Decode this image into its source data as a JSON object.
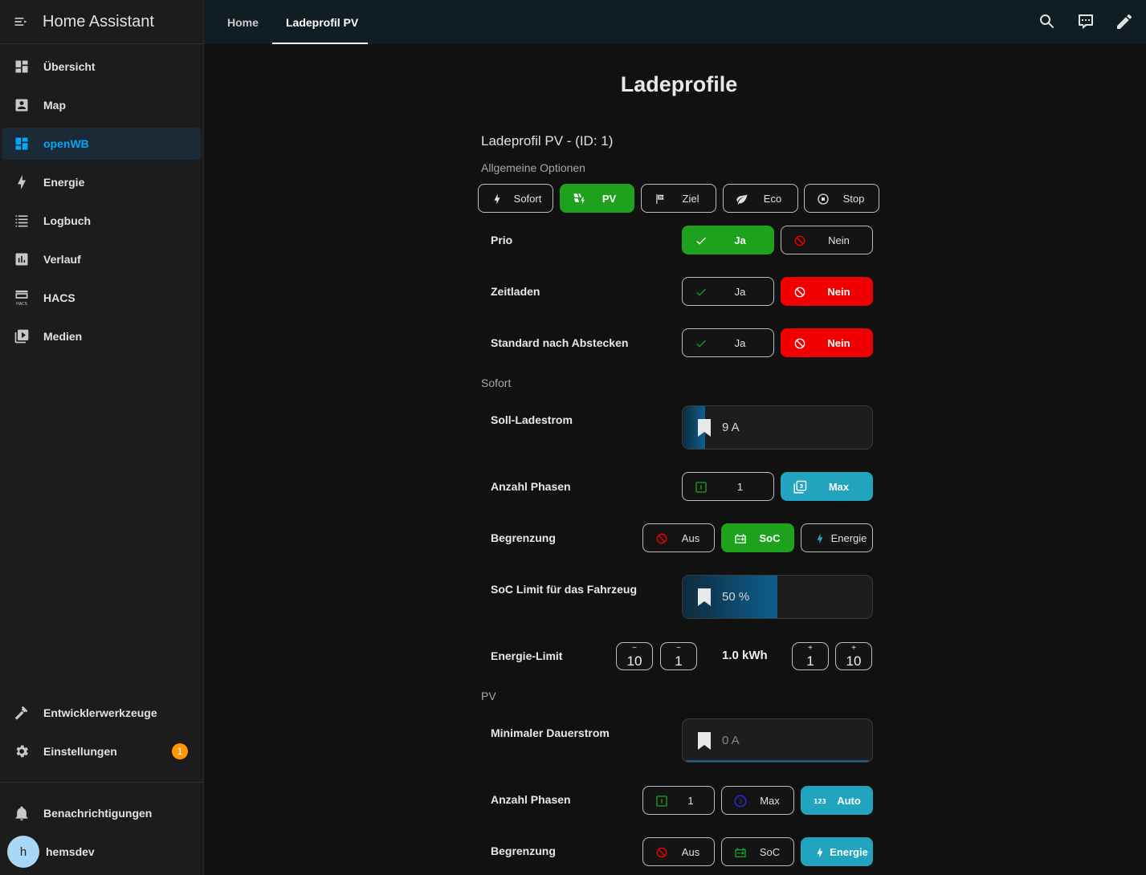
{
  "app": {
    "title": "Home Assistant"
  },
  "sidebar": {
    "items": [
      {
        "label": "Übersicht",
        "icon": "dashboard-icon"
      },
      {
        "label": "Map",
        "icon": "account-box-icon"
      },
      {
        "label": "openWB",
        "icon": "dashboard-icon",
        "active": true
      },
      {
        "label": "Energie",
        "icon": "lightning-bolt-icon"
      },
      {
        "label": "Logbuch",
        "icon": "list-icon"
      },
      {
        "label": "Verlauf",
        "icon": "chart-box-icon"
      },
      {
        "label": "HACS",
        "icon": "hacs-icon"
      },
      {
        "label": "Medien",
        "icon": "play-box-multiple-icon"
      }
    ],
    "bottom": [
      {
        "label": "Entwicklerwerkzeuge",
        "icon": "hammer-icon"
      },
      {
        "label": "Einstellungen",
        "icon": "gear-icon",
        "badge": "1"
      }
    ],
    "notifications": {
      "label": "Benachrichtigungen",
      "icon": "bell-icon"
    },
    "user": {
      "initial": "h",
      "name": "hemsdev"
    }
  },
  "topbar": {
    "tabs": [
      {
        "label": "Home"
      },
      {
        "label": "Ladeprofil PV",
        "active": true
      }
    ],
    "icons": [
      "search-icon",
      "assist-chat-icon",
      "edit-pencil-icon"
    ]
  },
  "page": {
    "title": "Ladeprofile",
    "card_title": "Ladeprofil PV - (ID: 1)",
    "sections": {
      "general": "Allgemeine Optionen",
      "sofort": "Sofort",
      "pv": "PV"
    },
    "modes": [
      {
        "label": "Sofort",
        "icon": "lightning-bolt-icon",
        "state": "off"
      },
      {
        "label": "PV",
        "icon": "solar-power-icon",
        "state": "on"
      },
      {
        "label": "Ziel",
        "icon": "flag-checkered-icon",
        "state": "off"
      },
      {
        "label": "Eco",
        "icon": "leaf-icon",
        "state": "off"
      },
      {
        "label": "Stop",
        "icon": "stop-circle-icon",
        "state": "off"
      }
    ],
    "rows": {
      "prio": {
        "label": "Prio",
        "yes": "Ja",
        "no": "Nein",
        "selected": "yes"
      },
      "zeitladen": {
        "label": "Zeitladen",
        "yes": "Ja",
        "no": "Nein",
        "selected": "no"
      },
      "standard": {
        "label": "Standard nach Abstecken",
        "yes": "Ja",
        "no": "Nein",
        "selected": "no"
      },
      "soll_ladestrom": {
        "label": "Soll-Ladestrom",
        "value": "9 A",
        "fraction": 0.12
      },
      "phasen_sofort": {
        "label": "Anzahl Phasen",
        "opt1": "1",
        "opt2": "Max",
        "selected": "Max"
      },
      "begrenzung_sofort": {
        "label": "Begrenzung",
        "opts": [
          "Aus",
          "SoC",
          "Energie"
        ],
        "selected": "SoC"
      },
      "soc_limit": {
        "label": "SoC Limit für das Fahrzeug",
        "value": "50 %",
        "fraction": 0.5
      },
      "energie_limit": {
        "label": "Energie-Limit",
        "minus10": "10",
        "minus1": "1",
        "value": "1.0 kWh",
        "plus1": "1",
        "plus10": "10",
        "minus_sign": "−",
        "plus_sign": "+"
      },
      "min_dauerstrom": {
        "label": "Minimaler Dauerstrom",
        "value": "0 A",
        "fraction": 0
      },
      "phasen_pv": {
        "label": "Anzahl Phasen",
        "opts": [
          "1",
          "Max",
          "Auto"
        ],
        "selected": "Auto"
      },
      "begrenzung_pv": {
        "label": "Begrenzung",
        "opts": [
          "Aus",
          "SoC",
          "Energie"
        ],
        "selected": "Energie"
      }
    }
  },
  "colors": {
    "accent": "#03a9f4",
    "green": "#1ea21e",
    "red": "#f00000",
    "teal": "#22a4bf",
    "badge": "#ff9800"
  }
}
